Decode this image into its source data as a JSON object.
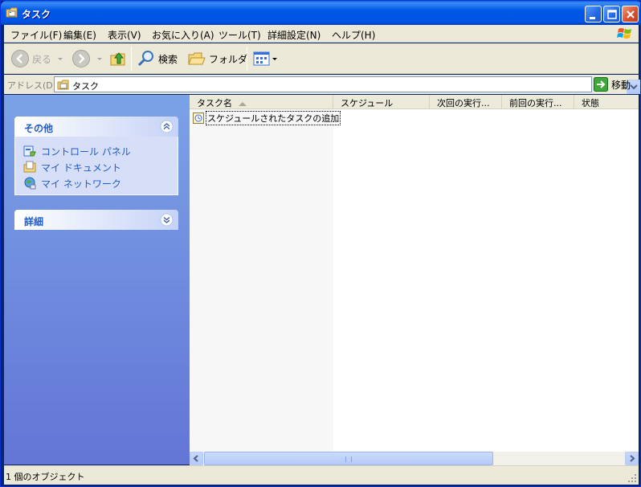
{
  "window": {
    "title": "タスク"
  },
  "menu": {
    "items": [
      {
        "label": "ファイル(F)"
      },
      {
        "label": "編集(E)"
      },
      {
        "label": "表示(V)"
      },
      {
        "label": "お気に入り(A)"
      },
      {
        "label": "ツール(T)"
      },
      {
        "label": "詳細設定(N)"
      },
      {
        "label": "ヘルプ(H)"
      }
    ]
  },
  "toolbar": {
    "back_label": "戻る",
    "search_label": "検索",
    "folders_label": "フォルダ"
  },
  "address": {
    "label": "アドレス(D)",
    "value": "タスク",
    "go_label": "移動"
  },
  "taskpane": {
    "other_places": {
      "title": "その他",
      "links": [
        {
          "label": "コントロール パネル",
          "icon": "control-panel-icon"
        },
        {
          "label": "マイ ドキュメント",
          "icon": "my-documents-icon"
        },
        {
          "label": "マイ ネットワーク",
          "icon": "my-network-icon"
        }
      ]
    },
    "details": {
      "title": "詳細"
    }
  },
  "listview": {
    "columns": [
      {
        "label": "タスク名",
        "sorted": "ascending"
      },
      {
        "label": "スケジュール"
      },
      {
        "label": "次回の実行..."
      },
      {
        "label": "前回の実行..."
      },
      {
        "label": "状態"
      }
    ],
    "rows": [
      {
        "name": "スケジュールされたタスクの追加",
        "icon": "add-task-icon"
      }
    ]
  },
  "status": {
    "text": "1 個のオブジェクト"
  },
  "colors": {
    "titlebar": "#0054e3",
    "taskpane_top": "#7ba2e7",
    "taskpane_bottom": "#6375d6",
    "link": "#215dc6"
  }
}
